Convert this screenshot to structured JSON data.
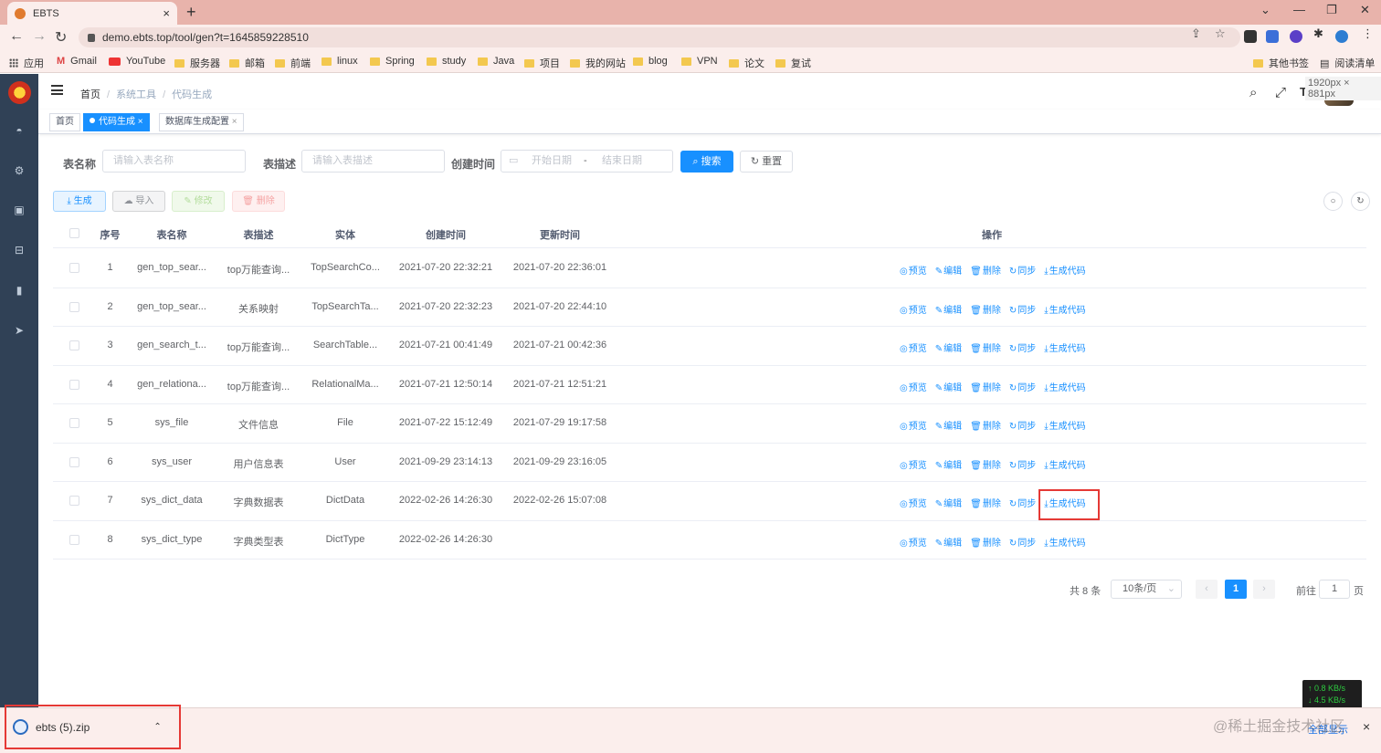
{
  "browser": {
    "tab_title": "EBTS",
    "tab_close": "×",
    "new_tab": "+",
    "url": "demo.ebts.top/tool/gen?t=1645859228510",
    "win_min": "⌄",
    "win_minimize": "—",
    "win_restore": "❐",
    "win_close": "✕",
    "bookmarks": [
      "应用",
      "Gmail",
      "YouTube",
      "服务器",
      "邮箱",
      "前端",
      "linux",
      "Spring",
      "study",
      "Java",
      "项目",
      "我的网站",
      "blog",
      "VPN",
      "论文",
      "复试"
    ],
    "other_bookmarks": "其他书签",
    "reading_list": "阅读清单"
  },
  "navbar": {
    "breadcrumb": [
      "首页",
      "系统工具",
      "代码生成"
    ],
    "size_tip": "1920px × 881px"
  },
  "tags": [
    {
      "label": "首页"
    },
    {
      "label": "代码生成",
      "close": "×"
    },
    {
      "label": "数据库生成配置",
      "close": "×"
    }
  ],
  "search": {
    "table_name_label": "表名称",
    "table_name_placeholder": "请输入表名称",
    "table_desc_label": "表描述",
    "table_desc_placeholder": "请输入表描述",
    "create_time_label": "创建时间",
    "start_placeholder": "开始日期",
    "range_sep": "-",
    "end_placeholder": "结束日期",
    "search_button": "搜索",
    "reset_button": "重置"
  },
  "toolbar": {
    "generate": "生成",
    "import": "导入",
    "edit": "修改",
    "delete": "删除"
  },
  "table": {
    "columns": [
      "序号",
      "表名称",
      "表描述",
      "实体",
      "创建时间",
      "更新时间",
      "操作"
    ],
    "rows": [
      {
        "no": "1",
        "name": "gen_top_sear...",
        "desc": "top万能查询...",
        "entity": "TopSearchCo...",
        "created": "2021-07-20 22:32:21",
        "updated": "2021-07-20 22:36:01"
      },
      {
        "no": "2",
        "name": "gen_top_sear...",
        "desc": "关系映射",
        "entity": "TopSearchTa...",
        "created": "2021-07-20 22:32:23",
        "updated": "2021-07-20 22:44:10"
      },
      {
        "no": "3",
        "name": "gen_search_t...",
        "desc": "top万能查询...",
        "entity": "SearchTable...",
        "created": "2021-07-21 00:41:49",
        "updated": "2021-07-21 00:42:36"
      },
      {
        "no": "4",
        "name": "gen_relationa...",
        "desc": "top万能查询...",
        "entity": "RelationalMa...",
        "created": "2021-07-21 12:50:14",
        "updated": "2021-07-21 12:51:21"
      },
      {
        "no": "5",
        "name": "sys_file",
        "desc": "文件信息",
        "entity": "File",
        "created": "2021-07-22 15:12:49",
        "updated": "2021-07-29 19:17:58"
      },
      {
        "no": "6",
        "name": "sys_user",
        "desc": "用户信息表",
        "entity": "User",
        "created": "2021-09-29 23:14:13",
        "updated": "2021-09-29 23:16:05"
      },
      {
        "no": "7",
        "name": "sys_dict_data",
        "desc": "字典数据表",
        "entity": "DictData",
        "created": "2022-02-26 14:26:30",
        "updated": "2022-02-26 15:07:08"
      },
      {
        "no": "8",
        "name": "sys_dict_type",
        "desc": "字典类型表",
        "entity": "DictType",
        "created": "2022-02-26 14:26:30",
        "updated": ""
      }
    ],
    "actions": [
      "预览",
      "编辑",
      "删除",
      "同步",
      "生成代码"
    ]
  },
  "pagination": {
    "total": "共 8 条",
    "page_size": "10条/页",
    "current_page": "1",
    "prev": "‹",
    "next": "›",
    "goto_label": "前往",
    "goto_value": "1",
    "page_suffix": "页"
  },
  "netspeed": {
    "up": "↑ 0.8 KB/s",
    "down": "↓ 4.5 KB/s"
  },
  "download": {
    "filename": "ebts (5).zip",
    "show_all": "全部显示",
    "close": "×"
  },
  "watermark": "@稀土掘金技术社区",
  "colors": {
    "primary": "#1890ff",
    "sidebar": "#304156",
    "highlight": "#e53935"
  }
}
